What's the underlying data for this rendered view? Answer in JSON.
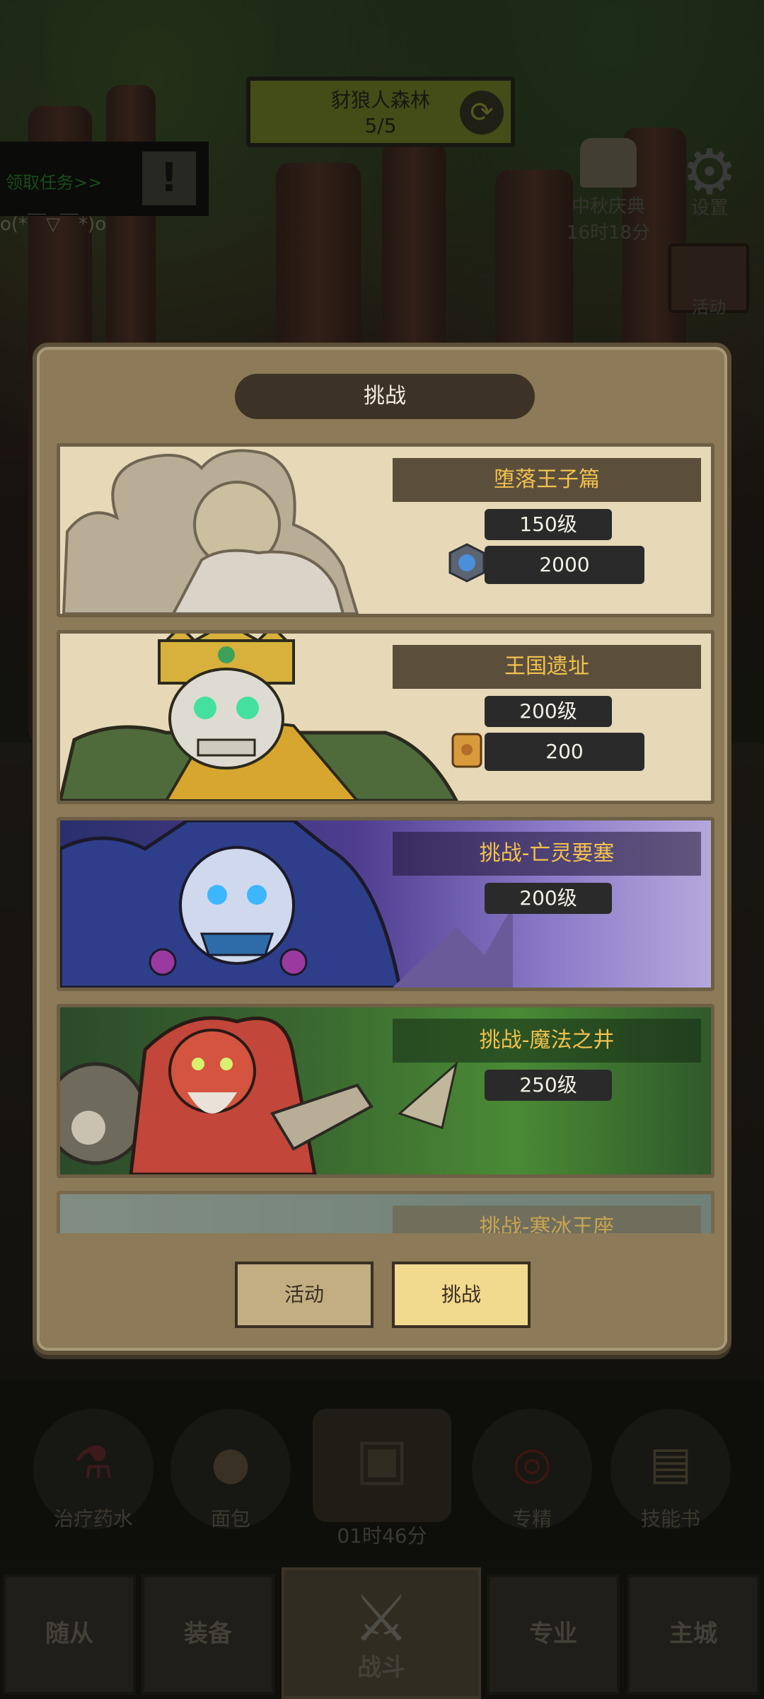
{
  "hud": {
    "location_name": "豺狼人森林",
    "location_progress": "5/5",
    "quest_label": "领取任务>>",
    "quest_alert": "!",
    "emote_text": "o(*￣▽￣*)o",
    "festival_label": "中秋庆典",
    "festival_timer": "16时18分",
    "settings_label": "设置",
    "activity_label": "活动"
  },
  "modal": {
    "title": "挑战",
    "cards": [
      {
        "chapter": "堕落王子篇",
        "level": "150级",
        "cost": "2000",
        "cost_icon": "blue-rune-icon"
      },
      {
        "chapter": "王国遗址",
        "level": "200级",
        "cost": "200",
        "cost_icon": "scroll-icon"
      },
      {
        "chapter": "挑战-亡灵要塞",
        "level": "200级"
      },
      {
        "chapter": "挑战-魔法之井",
        "level": "250级"
      },
      {
        "chapter": "挑战-寒冰王座"
      }
    ],
    "tabs": {
      "activity": "活动",
      "challenge": "挑战"
    }
  },
  "items": {
    "potion": "治疗药水",
    "bread": "面包",
    "chest_timer": "01时46分",
    "specialize": "专精",
    "skillbook": "技能书"
  },
  "nav": {
    "followers": "随从",
    "equipment": "装备",
    "battle": "战斗",
    "profession": "专业",
    "city": "主城"
  }
}
